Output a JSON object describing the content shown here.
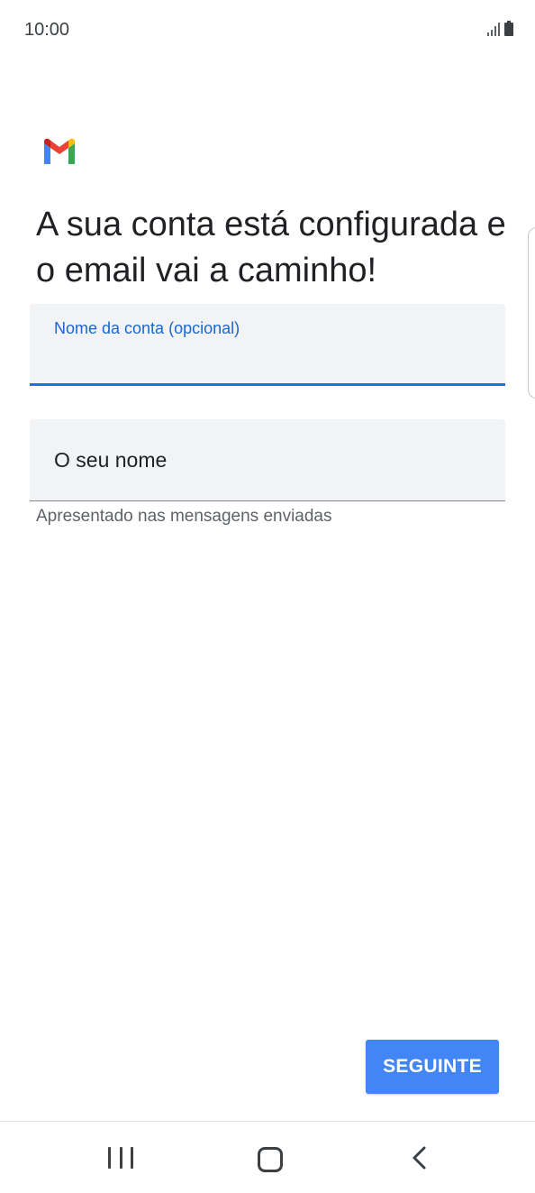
{
  "status_bar": {
    "time": "10:00",
    "icons": [
      "signal-icon",
      "battery-icon"
    ]
  },
  "app": {
    "logo": "gmail-logo",
    "brand_colors": {
      "blue": "#4285F4",
      "red": "#EA4335",
      "yellow": "#FBBC04",
      "green": "#34A853"
    }
  },
  "main": {
    "heading": "A sua conta está configurada e o email vai a caminho!",
    "account_name_field": {
      "label": "Nome da conta (opcional)",
      "value": "",
      "state": "focused",
      "accent_color": "#1A73E8"
    },
    "your_name_field": {
      "placeholder": "O seu nome",
      "value": "",
      "helper": "Apresentado nas mensagens enviadas"
    }
  },
  "actions": {
    "next_label": "SEGUINTE",
    "next_color": "#4285F4"
  },
  "nav_bar": {
    "icons": [
      "recents-icon",
      "home-icon",
      "back-icon"
    ]
  }
}
